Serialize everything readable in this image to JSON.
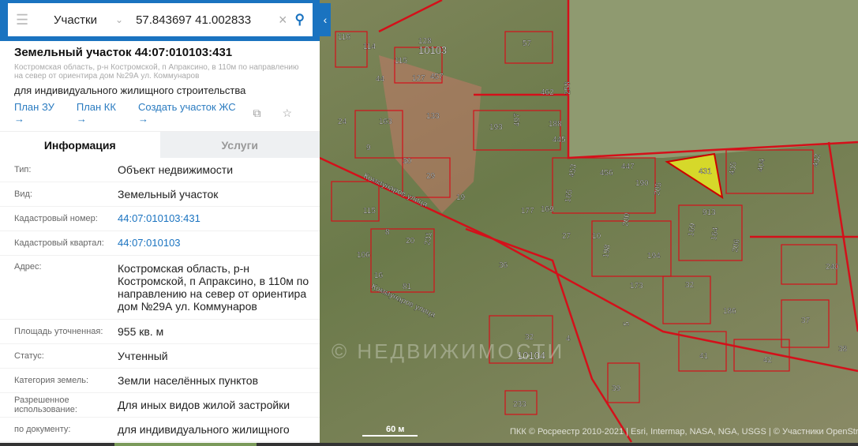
{
  "search": {
    "layer": "Участки",
    "query": "57.843697 41.002833"
  },
  "parcel": {
    "title": "Земельный участок 44:07:010103:431",
    "address": "Костромская область, р-н Костромской, п Апраксино, в 110м по направлению на север от ориентира дом №29А ул. Коммунаров",
    "purpose": "для индивидуального жилищного строительства"
  },
  "links": [
    "План ЗУ →",
    "План КК →",
    "Создать участок ЖС →"
  ],
  "tabs": {
    "info": "Информация",
    "services": "Услуги"
  },
  "rows": [
    {
      "k": "Тип:",
      "v": "Объект недвижимости"
    },
    {
      "k": "Вид:",
      "v": "Земельный участок"
    },
    {
      "k": "Кадастровый номер:",
      "v": "44:07:010103:431"
    },
    {
      "k": "Кадастровый квартал:",
      "v": "44:07:010103"
    },
    {
      "k": "Адрес:",
      "v": "Костромская область, р-н Костромской, п Апраксино, в 110м по направлению на север от ориентира дом №29А ул. Коммунаров"
    },
    {
      "k": "Площадь уточненная:",
      "v": "955 кв. м"
    },
    {
      "k": "Статус:",
      "v": "Учтенный"
    },
    {
      "k": "Категория земель:",
      "v": "Земли населённых пунктов"
    },
    {
      "k": "Разрешенное использование:",
      "v": "Для иных видов жилой застройки"
    },
    {
      "k": "по документу:",
      "v": "для индивидуального жилищного"
    }
  ],
  "map": {
    "labels": [
      "116",
      "114",
      "128",
      "10103",
      "115",
      "127",
      "457",
      "57",
      "44",
      "462",
      "258",
      "24",
      "163",
      "133",
      "193",
      "497",
      "188",
      "445",
      "9",
      "30",
      "431",
      "435",
      "404",
      "432",
      "29",
      "19",
      "453",
      "456",
      "447",
      "190",
      "205",
      "115",
      "177",
      "169",
      "165",
      "27",
      "10",
      "200",
      "198",
      "194",
      "169",
      "913",
      "164",
      "206",
      "8",
      "20",
      "231",
      "106",
      "16",
      "81",
      "36",
      "173",
      "32",
      "240",
      "186",
      "37",
      "38",
      "32",
      "10104",
      "4",
      "5",
      "41",
      "42",
      "39",
      "233",
      "Коммунаров улица",
      "Коммунаров улица"
    ],
    "scale": "60 м",
    "attribution": "ПКК © Росреестр 2010-2021 | Esri, Intermap, NASA, NGA, USGS | © Участники OpenStreetMap",
    "watermark": "© НЕДВИЖИМОСТИ"
  }
}
